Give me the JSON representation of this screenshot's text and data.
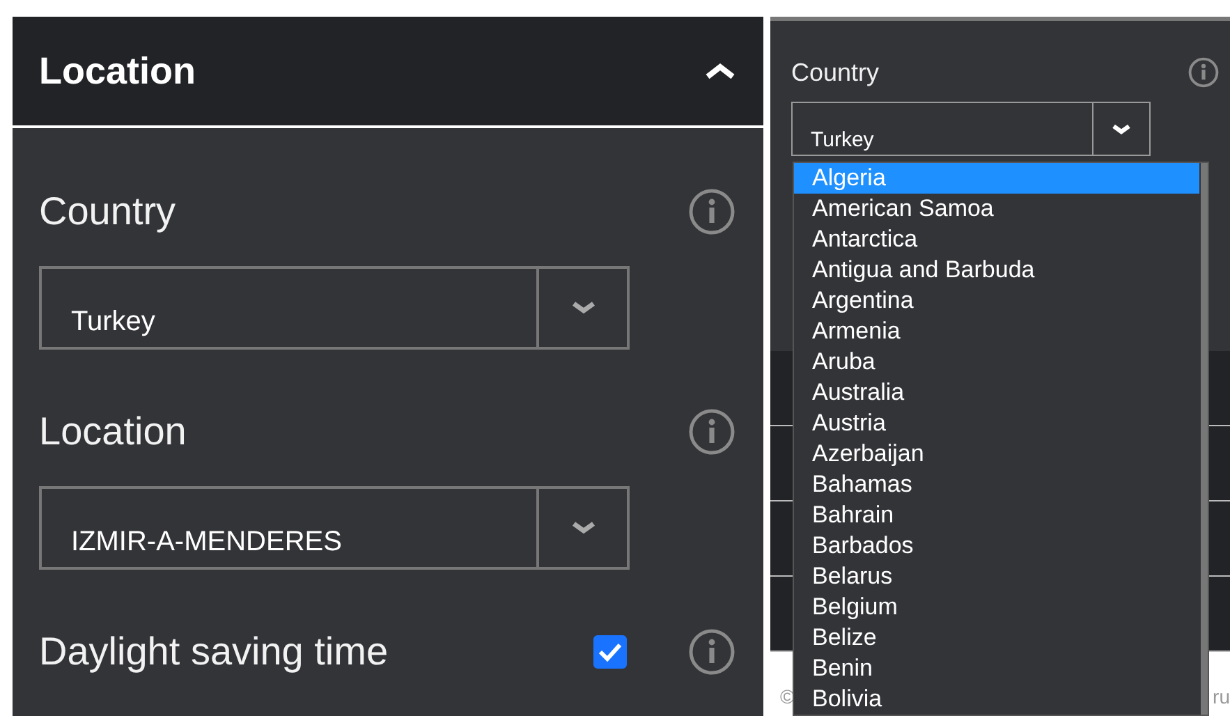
{
  "left_panel": {
    "title": "Location",
    "expanded": true,
    "fields": [
      {
        "kind": "select",
        "label": "Country",
        "value": "Turkey"
      },
      {
        "kind": "select",
        "label": "Location",
        "value": "IZMIR-A-MENDERES"
      },
      {
        "kind": "checkbox",
        "label": "Daylight saving time",
        "checked": true
      }
    ]
  },
  "right_panel": {
    "field": {
      "label": "Country",
      "value": "Turkey"
    },
    "dropdown": {
      "options": [
        {
          "label": "Algeria",
          "selected": true
        },
        {
          "label": "American Samoa",
          "selected": false
        },
        {
          "label": "Antarctica",
          "selected": false
        },
        {
          "label": "Antigua and Barbuda",
          "selected": false
        },
        {
          "label": "Argentina",
          "selected": false
        },
        {
          "label": "Armenia",
          "selected": false
        },
        {
          "label": "Aruba",
          "selected": false
        },
        {
          "label": "Australia",
          "selected": false
        },
        {
          "label": "Austria",
          "selected": false
        },
        {
          "label": "Azerbaijan",
          "selected": false
        },
        {
          "label": "Bahamas",
          "selected": false
        },
        {
          "label": "Bahrain",
          "selected": false
        },
        {
          "label": "Barbados",
          "selected": false
        },
        {
          "label": "Belarus",
          "selected": false
        },
        {
          "label": "Belgium",
          "selected": false
        },
        {
          "label": "Belize",
          "selected": false
        },
        {
          "label": "Benin",
          "selected": false
        },
        {
          "label": "Bolivia",
          "selected": false
        }
      ]
    },
    "footer": {
      "left": "©",
      "right": "ru"
    }
  }
}
